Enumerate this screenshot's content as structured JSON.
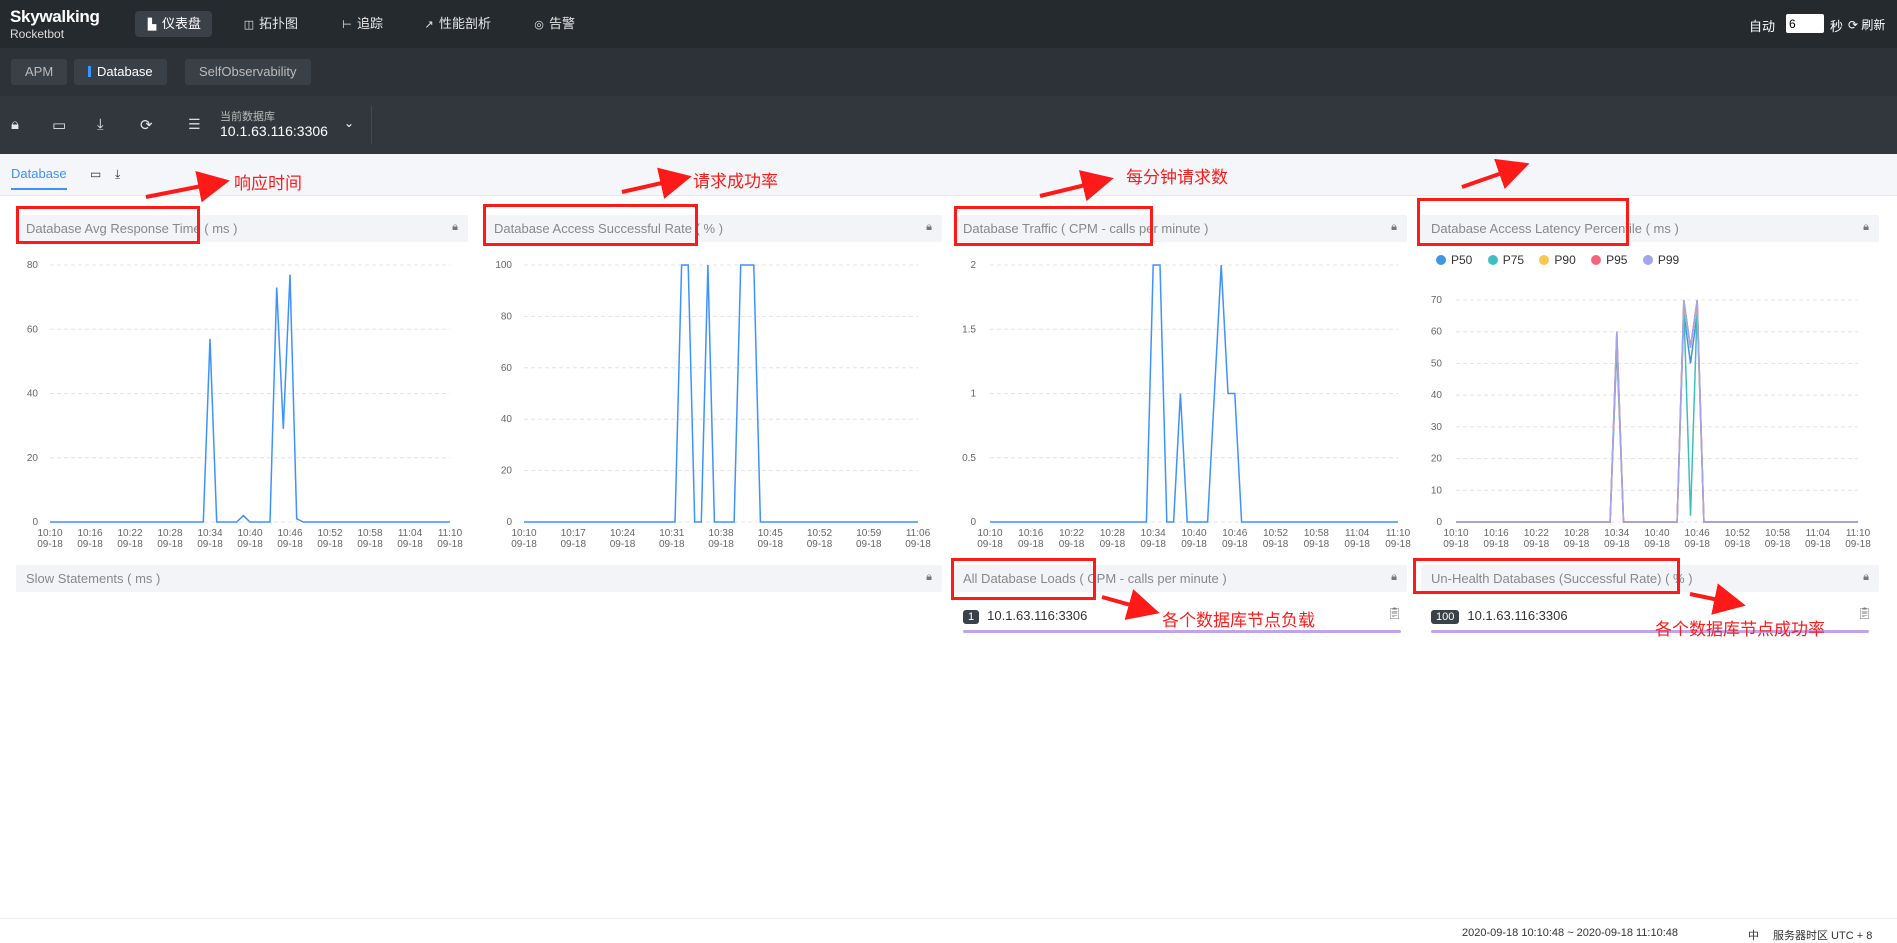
{
  "app": {
    "logo_line1": "Skywalking",
    "logo_line2": "Rocketbot"
  },
  "nav": [
    {
      "label": "仪表盘",
      "icon": "dashboard-icon"
    },
    {
      "label": "拓扑图",
      "icon": "topology-icon"
    },
    {
      "label": "追踪",
      "icon": "trace-icon"
    },
    {
      "label": "性能剖析",
      "icon": "profile-icon"
    },
    {
      "label": "告警",
      "icon": "alarm-icon"
    }
  ],
  "header": {
    "auto_label": "自动",
    "interval_value": "6",
    "interval_unit": "秒",
    "refresh_label": "刷新"
  },
  "tabs": [
    {
      "label": "APM"
    },
    {
      "label": "Database"
    },
    {
      "label": "SelfObservability"
    }
  ],
  "toolbar": {
    "db_caption": "当前数据库",
    "db_value": "10.1.63.116:3306"
  },
  "subtab": {
    "label": "Database"
  },
  "panels": {
    "avg_response": "Database Avg Response Time ( ms )",
    "success_rate": "Database Access Successful Rate ( % )",
    "traffic": "Database Traffic ( CPM - calls per minute )",
    "latency": "Database Access Latency Percentile ( ms )",
    "slow": "Slow Statements ( ms )",
    "loads": "All Database Loads ( CPM - calls per minute )",
    "unhealth": "Un-Health Databases (Successful Rate) ( % )"
  },
  "loads_list": [
    {
      "badge": "1",
      "name": "10.1.63.116:3306"
    }
  ],
  "unhealth_list": [
    {
      "badge": "100",
      "name": "10.1.63.116:3306"
    }
  ],
  "annotations": {
    "response": "响应时间",
    "success": "请求成功率",
    "cpm": "每分钟请求数",
    "loads": "各个数据库节点负载",
    "unhealth": "各个数据库节点成功率"
  },
  "footer": {
    "range": "2020-09-18 10:10:48 ~ 2020-09-18 11:10:48",
    "lang": "中",
    "timezone": "服务器时区 UTC + 8"
  },
  "colors": {
    "line": "#3d92ff",
    "p50": "#3f96e3",
    "p75": "#3fbec0",
    "p90": "#f9c74f",
    "p95": "#f8647c",
    "p99": "#a4a4ec",
    "annotation": "#ff1a1a"
  },
  "chart_data": [
    {
      "type": "line",
      "title": "Database Avg Response Time ( ms )",
      "x_ticks": [
        "10:10\n09-18",
        "10:16\n09-18",
        "10:22\n09-18",
        "10:28\n09-18",
        "10:34\n09-18",
        "10:40\n09-18",
        "10:46\n09-18",
        "10:52\n09-18",
        "10:58\n09-18",
        "11:04\n09-18",
        "11:10\n09-18"
      ],
      "ylim": [
        0,
        80
      ],
      "y_ticks": [
        0,
        20,
        40,
        60,
        80
      ],
      "series": [
        {
          "values": [
            0,
            0,
            0,
            0,
            0,
            0,
            0,
            0,
            0,
            0,
            0,
            0,
            0,
            0,
            0,
            0,
            0,
            0,
            0,
            0,
            0,
            0,
            0,
            0,
            57,
            0,
            0,
            0,
            0,
            2,
            0,
            0,
            0,
            0,
            73,
            29,
            77,
            1,
            0,
            0,
            0,
            0,
            0,
            0,
            0,
            0,
            0,
            0,
            0,
            0,
            0,
            0,
            0,
            0,
            0,
            0,
            0,
            0,
            0,
            0,
            0
          ]
        }
      ]
    },
    {
      "type": "line",
      "title": "Database Access Successful Rate ( % )",
      "x_ticks": [
        "10:10\n09-18",
        "10:17\n09-18",
        "10:24\n09-18",
        "10:31\n09-18",
        "10:38\n09-18",
        "10:45\n09-18",
        "10:52\n09-18",
        "10:59\n09-18",
        "11:06\n09-18"
      ],
      "ylim": [
        0,
        100
      ],
      "y_ticks": [
        0,
        20,
        40,
        60,
        80,
        100
      ],
      "series": [
        {
          "values": [
            0,
            0,
            0,
            0,
            0,
            0,
            0,
            0,
            0,
            0,
            0,
            0,
            0,
            0,
            0,
            0,
            0,
            0,
            0,
            0,
            0,
            0,
            0,
            0,
            100,
            100,
            0,
            0,
            100,
            0,
            0,
            0,
            0,
            100,
            100,
            100,
            0,
            0,
            0,
            0,
            0,
            0,
            0,
            0,
            0,
            0,
            0,
            0,
            0,
            0,
            0,
            0,
            0,
            0,
            0,
            0,
            0,
            0,
            0,
            0,
            0
          ]
        }
      ]
    },
    {
      "type": "line",
      "title": "Database Traffic ( CPM - calls per minute )",
      "x_ticks": [
        "10:10\n09-18",
        "10:16\n09-18",
        "10:22\n09-18",
        "10:28\n09-18",
        "10:34\n09-18",
        "10:40\n09-18",
        "10:46\n09-18",
        "10:52\n09-18",
        "10:58\n09-18",
        "11:04\n09-18",
        "11:10\n09-18"
      ],
      "ylim": [
        0,
        2
      ],
      "y_ticks": [
        0,
        0.5,
        1,
        1.5,
        2
      ],
      "series": [
        {
          "values": [
            0,
            0,
            0,
            0,
            0,
            0,
            0,
            0,
            0,
            0,
            0,
            0,
            0,
            0,
            0,
            0,
            0,
            0,
            0,
            0,
            0,
            0,
            0,
            0,
            2,
            2,
            0,
            0,
            1,
            0,
            0,
            0,
            0,
            1,
            2,
            1,
            1,
            0,
            0,
            0,
            0,
            0,
            0,
            0,
            0,
            0,
            0,
            0,
            0,
            0,
            0,
            0,
            0,
            0,
            0,
            0,
            0,
            0,
            0,
            0,
            0
          ]
        }
      ]
    },
    {
      "type": "line",
      "title": "Database Access Latency Percentile ( ms )",
      "x_ticks": [
        "10:10\n09-18",
        "10:16\n09-18",
        "10:22\n09-18",
        "10:28\n09-18",
        "10:34\n09-18",
        "10:40\n09-18",
        "10:46\n09-18",
        "10:52\n09-18",
        "10:58\n09-18",
        "11:04\n09-18",
        "11:10\n09-18"
      ],
      "ylim": [
        0,
        70
      ],
      "y_ticks": [
        0,
        10,
        20,
        30,
        40,
        50,
        60,
        70
      ],
      "series": [
        {
          "name": "P50",
          "values": [
            0,
            0,
            0,
            0,
            0,
            0,
            0,
            0,
            0,
            0,
            0,
            0,
            0,
            0,
            0,
            0,
            0,
            0,
            0,
            0,
            0,
            0,
            0,
            0,
            55,
            0,
            0,
            0,
            0,
            0,
            0,
            0,
            0,
            0,
            66,
            50,
            66,
            0,
            0,
            0,
            0,
            0,
            0,
            0,
            0,
            0,
            0,
            0,
            0,
            0,
            0,
            0,
            0,
            0,
            0,
            0,
            0,
            0,
            0,
            0,
            0
          ]
        },
        {
          "name": "P75",
          "values": [
            0,
            0,
            0,
            0,
            0,
            0,
            0,
            0,
            0,
            0,
            0,
            0,
            0,
            0,
            0,
            0,
            0,
            0,
            0,
            0,
            0,
            0,
            0,
            0,
            57,
            0,
            0,
            0,
            0,
            0,
            0,
            0,
            0,
            0,
            68,
            2,
            68,
            0,
            0,
            0,
            0,
            0,
            0,
            0,
            0,
            0,
            0,
            0,
            0,
            0,
            0,
            0,
            0,
            0,
            0,
            0,
            0,
            0,
            0,
            0,
            0
          ]
        },
        {
          "name": "P90",
          "values": [
            0,
            0,
            0,
            0,
            0,
            0,
            0,
            0,
            0,
            0,
            0,
            0,
            0,
            0,
            0,
            0,
            0,
            0,
            0,
            0,
            0,
            0,
            0,
            0,
            59,
            0,
            0,
            0,
            0,
            0,
            0,
            0,
            0,
            0,
            69,
            55,
            69,
            0,
            0,
            0,
            0,
            0,
            0,
            0,
            0,
            0,
            0,
            0,
            0,
            0,
            0,
            0,
            0,
            0,
            0,
            0,
            0,
            0,
            0,
            0,
            0
          ]
        },
        {
          "name": "P95",
          "values": [
            0,
            0,
            0,
            0,
            0,
            0,
            0,
            0,
            0,
            0,
            0,
            0,
            0,
            0,
            0,
            0,
            0,
            0,
            0,
            0,
            0,
            0,
            0,
            0,
            60,
            0,
            0,
            0,
            0,
            0,
            0,
            0,
            0,
            0,
            70,
            55,
            70,
            0,
            0,
            0,
            0,
            0,
            0,
            0,
            0,
            0,
            0,
            0,
            0,
            0,
            0,
            0,
            0,
            0,
            0,
            0,
            0,
            0,
            0,
            0,
            0
          ]
        },
        {
          "name": "P99",
          "values": [
            0,
            0,
            0,
            0,
            0,
            0,
            0,
            0,
            0,
            0,
            0,
            0,
            0,
            0,
            0,
            0,
            0,
            0,
            0,
            0,
            0,
            0,
            0,
            0,
            60,
            0,
            0,
            0,
            0,
            0,
            0,
            0,
            0,
            0,
            70,
            55,
            70,
            0,
            0,
            0,
            0,
            0,
            0,
            0,
            0,
            0,
            0,
            0,
            0,
            0,
            0,
            0,
            0,
            0,
            0,
            0,
            0,
            0,
            0,
            0,
            0
          ]
        }
      ]
    }
  ]
}
